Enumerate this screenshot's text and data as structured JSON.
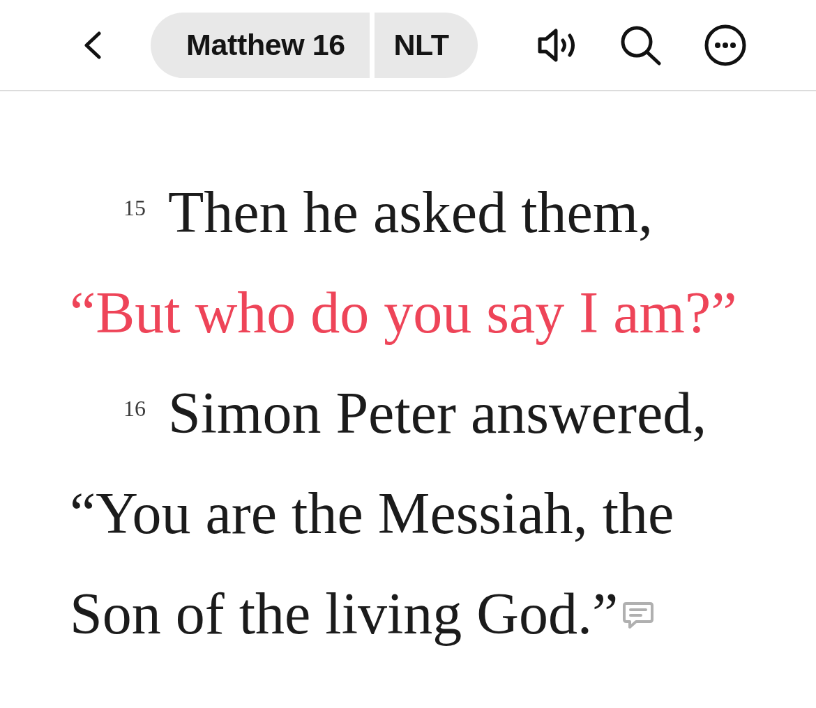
{
  "header": {
    "reference": "Matthew 16",
    "version": "NLT"
  },
  "verses": [
    {
      "number": "15",
      "lines": [
        {
          "text": "Then he asked them,",
          "red_letter": false
        },
        {
          "text": "“But who do you say I am?”",
          "red_letter": true
        }
      ],
      "has_note": false
    },
    {
      "number": "16",
      "lines": [
        {
          "text": "Simon Peter answered,",
          "red_letter": false
        },
        {
          "text": "“You are the Messiah, the",
          "red_letter": false
        },
        {
          "text": "Son of the living God.”",
          "red_letter": false
        }
      ],
      "has_note": true
    }
  ]
}
